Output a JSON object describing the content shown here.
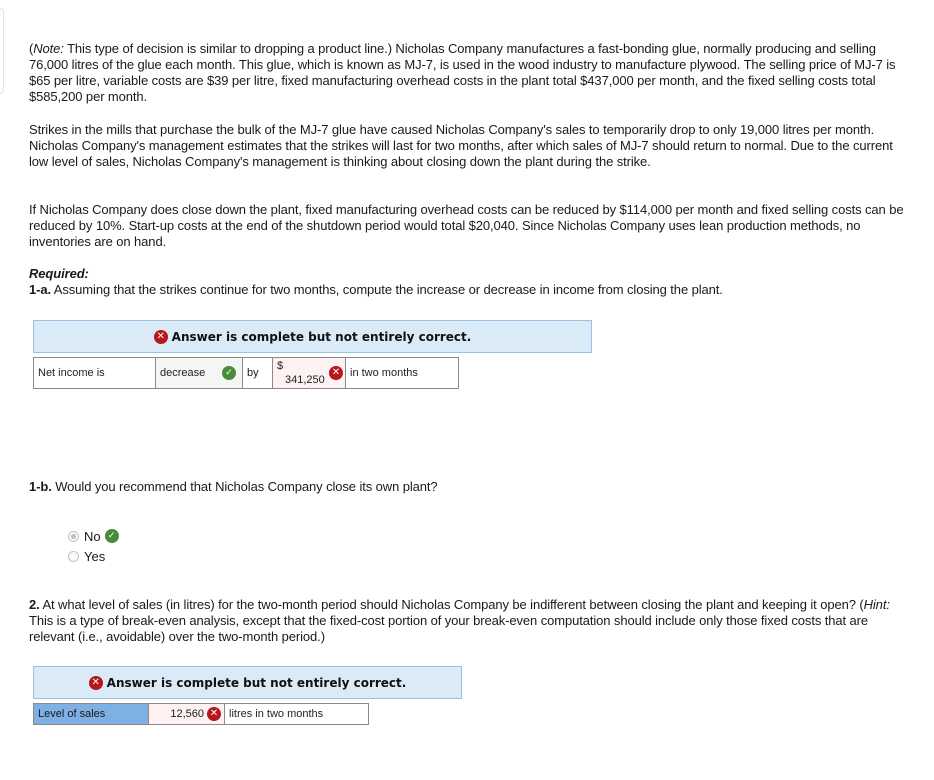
{
  "problem": {
    "paragraph1": {
      "note_label": "Note:",
      "text_open": "(",
      "text": " This type of decision is similar to dropping a product line.) Nicholas Company manufactures a fast-bonding glue, normally producing and selling 76,000 litres of the glue each month. This glue, which is known as MJ-7, is used in the wood industry to manufacture plywood. The selling price of MJ-7 is $65 per litre, variable costs are $39 per litre, fixed manufacturing overhead costs in the plant total $437,000 per month, and the fixed selling costs total $585,200 per month."
    },
    "paragraph2": "Strikes in the mills that purchase the bulk of the MJ-7 glue have caused Nicholas Company's sales to temporarily drop to only 19,000 litres per month. Nicholas Company's management estimates that the strikes will last for two months, after which sales of MJ-7 should return to normal. Due to the current low level of sales, Nicholas Company's management is thinking about closing down the plant during the strike.",
    "paragraph3": "If Nicholas Company does close down the plant, fixed manufacturing overhead costs can be reduced by $114,000 per month and fixed selling costs can be reduced by 10%. Start-up costs at the end of the shutdown period would total $20,040. Since Nicholas Company uses lean production methods, no inventories are on hand.",
    "required_label": "Required:"
  },
  "q1a": {
    "number": "1-a.",
    "text": " Assuming that the strikes continue for two months, compute the increase or decrease in income from closing the plant.",
    "banner": "Answer is complete but not entirely correct.",
    "row": {
      "label": "Net income is",
      "selection": "decrease",
      "selection_status": "correct",
      "connector": "by",
      "currency": "$",
      "amount": "341,250",
      "amount_status": "incorrect",
      "suffix": "in two months"
    }
  },
  "q1b": {
    "number": "1-b.",
    "text": " Would you recommend that Nicholas Company close its own plant?",
    "options": [
      {
        "label": "No",
        "selected": true,
        "status": "correct"
      },
      {
        "label": "Yes",
        "selected": false
      }
    ]
  },
  "q2": {
    "number": "2.",
    "text_a": " At what level of sales (in litres) for the two-month period should Nicholas Company be indifferent between closing the plant and keeping it open? (",
    "hint_label": "Hint:",
    "text_b": " This is a type of break-even analysis, except that the fixed-cost portion of your break-even computation should include only those fixed costs that are relevant (i.e., avoidable) over the two-month period.)",
    "banner": "Answer is complete but not entirely correct.",
    "row": {
      "label": "Level of sales",
      "value": "12,560",
      "value_status": "incorrect",
      "suffix": "litres in two months"
    }
  },
  "icons": {
    "incorrect": "✕",
    "correct": "✓"
  },
  "colors": {
    "incorrect": "#b8161d",
    "correct": "#4a8a3b",
    "banner_bg": "#daeaf7",
    "label_highlight": "#7fb0e4"
  }
}
